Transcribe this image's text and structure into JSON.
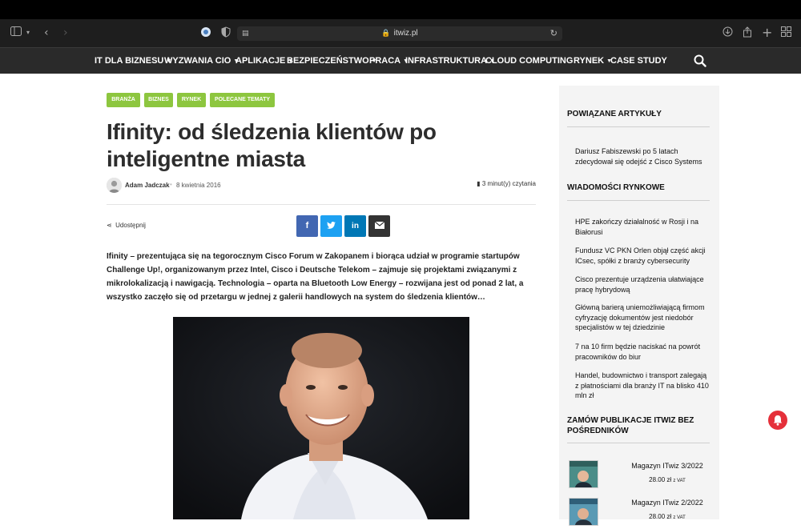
{
  "browser": {
    "url": "itwiz.pl",
    "icons": [
      "sidebar-icon",
      "chevron-down-icon",
      "back-icon",
      "forward-icon",
      "extension-icon",
      "shield-icon",
      "page-icon",
      "lock-icon",
      "reload-icon",
      "download-icon",
      "share-icon",
      "new-tab-icon",
      "tabs-overview-icon"
    ]
  },
  "nav": {
    "items": [
      {
        "label": "IT DLA BIZNESU",
        "dropdown": true
      },
      {
        "label": "WYZWANIA CIO",
        "dropdown": true
      },
      {
        "label": "APLIKACJE",
        "dropdown": true
      },
      {
        "label": "BEZPIECZEŃSTWO",
        "dropdown": true
      },
      {
        "label": "PRACA",
        "dropdown": true
      },
      {
        "label": "INFRASTRUKTURA",
        "dropdown": true
      },
      {
        "label": "CLOUD COMPUTING",
        "dropdown": false
      },
      {
        "label": "RYNEK",
        "dropdown": true
      },
      {
        "label": "CASE STUDY",
        "dropdown": false
      }
    ],
    "search_icon": "search-icon"
  },
  "article": {
    "tags": [
      "BRANŻA",
      "BIZNES",
      "RYNEK",
      "POLECANE TEMATY"
    ],
    "title": "Ifinity: od śledzenia klientów po inteligentne miasta",
    "author": "Adam Jadczak",
    "date": "8 kwietnia 2016",
    "read_time": "3 minut(y) czytania",
    "share_label": "Udostępnij",
    "share_buttons": [
      {
        "name": "facebook",
        "glyph": "f",
        "color": "#4267b2"
      },
      {
        "name": "twitter",
        "glyph": "t",
        "color": "#1da1f2"
      },
      {
        "name": "linkedin",
        "glyph": "in",
        "color": "#0077b5"
      },
      {
        "name": "email",
        "glyph": "✉",
        "color": "#333333"
      }
    ],
    "lead": "Ifinity – prezentująca się na tegorocznym Cisco Forum w Zakopanem i biorąca udział w programie startupów Challenge Up!, organizowanym przez Intel, Cisco i Deutsche Telekom – zajmuje się projektami związanymi z mikrolokalizacją i nawigacją. Technologia – oparta na Bluetooth Low Energy – rozwijana jest od ponad 2 lat, a wszystko zaczęło się od przetargu w jednej z galerii handlowych na system do śledzenia klientów…"
  },
  "sidebar": {
    "related_heading": "POWIĄZANE ARTYKUŁY",
    "related": [
      "Dariusz Fabiszewski po 5 latach zdecydował się odejść z Cisco Systems"
    ],
    "market_heading": "WIADOMOŚCI RYNKOWE",
    "market": [
      "HPE zakończy działalność w Rosji i na Białorusi",
      "Fundusz VC PKN Orlen objął część akcji ICsec, spółki z branży cybersecurity",
      "Cisco prezentuje urządzenia ułatwiające pracę hybrydową",
      "Główną barierą uniemożliwiającą firmom cyfryzację dokumentów jest niedobór specjalistów w tej dziedzinie",
      "7 na 10 firm będzie naciskać na powrót pracowników do biur",
      "Handel, budownictwo i transport zalegają z płatnościami dla branży IT na blisko 410 mln zł"
    ],
    "order_heading": "ZAMÓW PUBLIKACJE ITWIZ BEZ POŚREDNIKÓW",
    "products": [
      {
        "title": "Magazyn ITwiz 3/2022",
        "price": "28.00 zł",
        "vat": "z VAT"
      },
      {
        "title": "Magazyn ITwiz 2/2022",
        "price": "28.00 zł",
        "vat": "z VAT"
      }
    ]
  },
  "notification_icon": "bell-icon"
}
